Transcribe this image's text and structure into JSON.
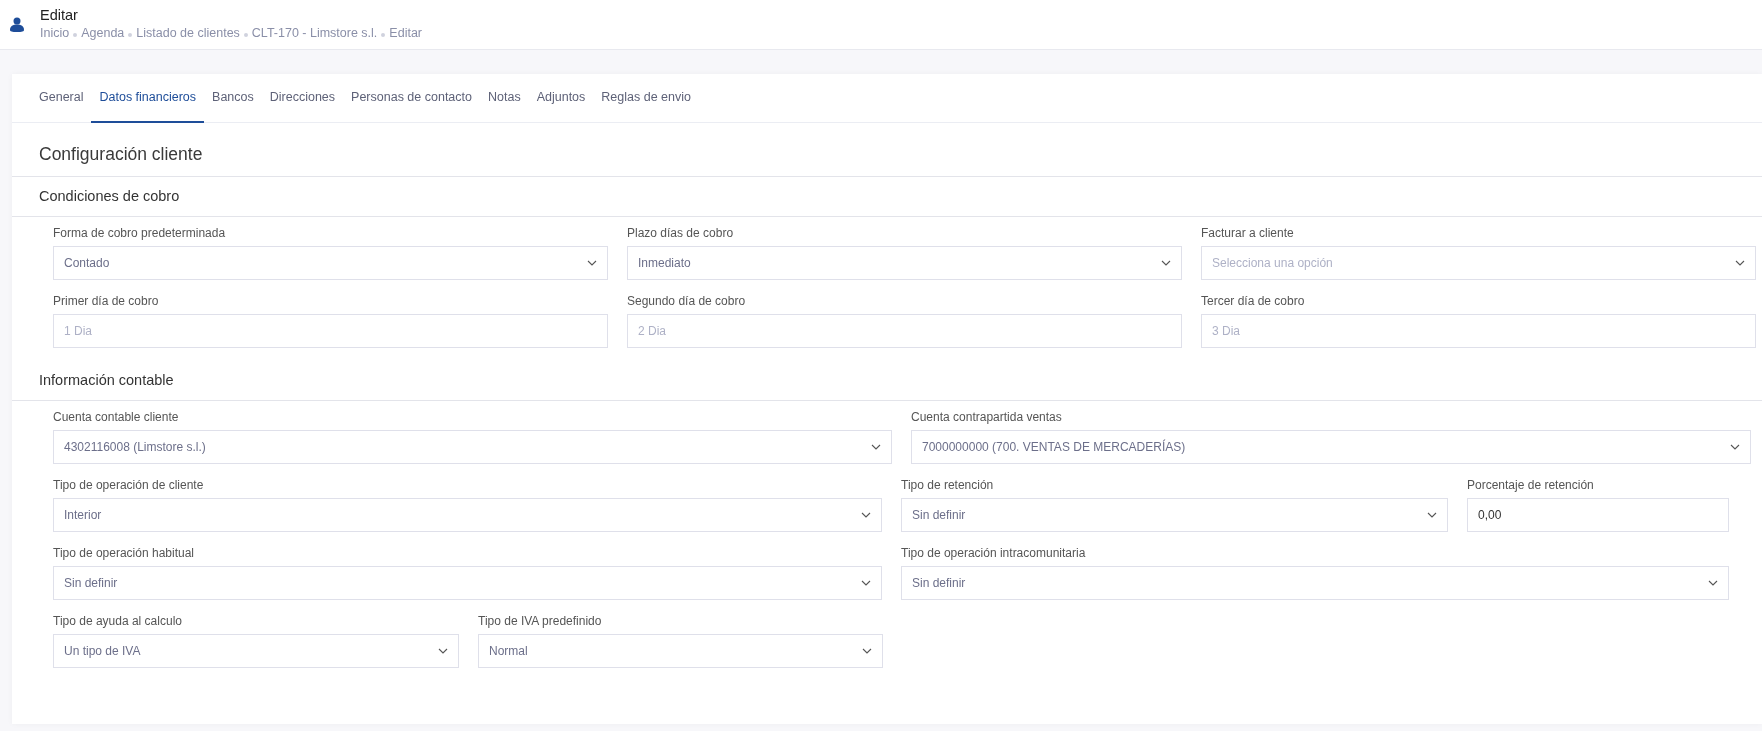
{
  "header": {
    "title": "Editar",
    "breadcrumb": [
      "Inicio",
      "Agenda",
      "Listado de clientes",
      "CLT-170 - Limstore s.l.",
      "Editar"
    ]
  },
  "tabs": [
    {
      "label": "General",
      "selected": false
    },
    {
      "label": "Datos financieros",
      "selected": true
    },
    {
      "label": "Bancos",
      "selected": false
    },
    {
      "label": "Direcciones",
      "selected": false
    },
    {
      "label": "Personas de contacto",
      "selected": false
    },
    {
      "label": "Notas",
      "selected": false
    },
    {
      "label": "Adjuntos",
      "selected": false
    },
    {
      "label": "Reglas de envio",
      "selected": false
    }
  ],
  "page_title": "Configuración cliente",
  "sections": [
    {
      "title": "Condiciones de cobro",
      "rows": [
        [
          {
            "label": "Forma de cobro predeterminada",
            "kind": "select",
            "value": "Contado"
          },
          {
            "label": "Plazo días de cobro",
            "kind": "select",
            "value": "Inmediato"
          },
          {
            "label": "Facturar a cliente",
            "kind": "select",
            "placeholder": "Selecciona una opción"
          }
        ],
        [
          {
            "label": "Primer día de cobro",
            "kind": "input",
            "placeholder": "1 Dia"
          },
          {
            "label": "Segundo día de cobro",
            "kind": "input",
            "placeholder": "2 Dia"
          },
          {
            "label": "Tercer día de cobro",
            "kind": "input",
            "placeholder": "3 Dia"
          }
        ]
      ]
    },
    {
      "title": "Información contable",
      "rows": [
        [
          {
            "label": "Cuenta contable cliente",
            "kind": "select",
            "value": "4302116008 (Limstore s.l.)"
          },
          {
            "label": "Cuenta contrapartida ventas",
            "kind": "select",
            "value": "7000000000 (700. VENTAS DE MERCADERÍAS)"
          }
        ],
        [
          {
            "label": "Tipo de operación de cliente",
            "kind": "select",
            "value": "Interior"
          },
          {
            "label": "Tipo de retención",
            "kind": "select",
            "value": "Sin definir"
          },
          {
            "label": "Porcentaje de retención",
            "kind": "input",
            "value": "0,00"
          }
        ],
        [
          {
            "label": "Tipo de operación habitual",
            "kind": "select",
            "value": "Sin definir"
          },
          {
            "label": "Tipo de operación intracomunitaria",
            "kind": "select",
            "value": "Sin definir"
          }
        ],
        [
          {
            "label": "Tipo de ayuda al calculo",
            "kind": "select",
            "value": "Un tipo de IVA"
          },
          {
            "label": "Tipo de IVA predefinido",
            "kind": "select",
            "value": "Normal"
          }
        ]
      ]
    }
  ]
}
